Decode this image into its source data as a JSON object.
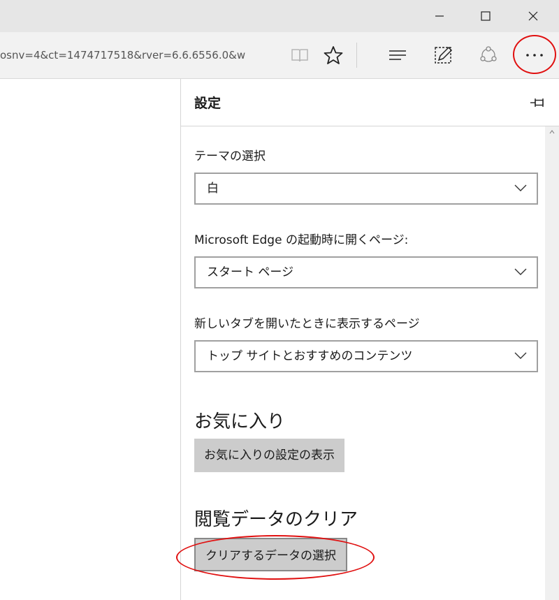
{
  "window": {
    "minimize_icon": "minimize-icon",
    "maximize_icon": "maximize-icon",
    "close_icon": "close-icon"
  },
  "toolbar": {
    "url": "osnv=4&ct=1474717518&rver=6.6.6556.0&w",
    "icons": [
      "reading-view-icon",
      "favorite-star-icon",
      "hub-icon",
      "web-note-icon",
      "share-icon",
      "more-icon"
    ]
  },
  "settings": {
    "title": "設定",
    "theme": {
      "label": "テーマの選択",
      "value": "白"
    },
    "startup": {
      "label": "Microsoft Edge の起動時に開くページ:",
      "value": "スタート ページ"
    },
    "new_tab": {
      "label": "新しいタブを開いたときに表示するページ",
      "value": "トップ サイトとおすすめのコンテンツ"
    },
    "favorites": {
      "heading": "お気に入り",
      "button": "お気に入りの設定の表示"
    },
    "clear_data": {
      "heading": "閲覧データのクリア",
      "button": "クリアするデータの選択"
    }
  },
  "colors": {
    "highlight": "#e01010",
    "button_bg": "#cccccc"
  }
}
